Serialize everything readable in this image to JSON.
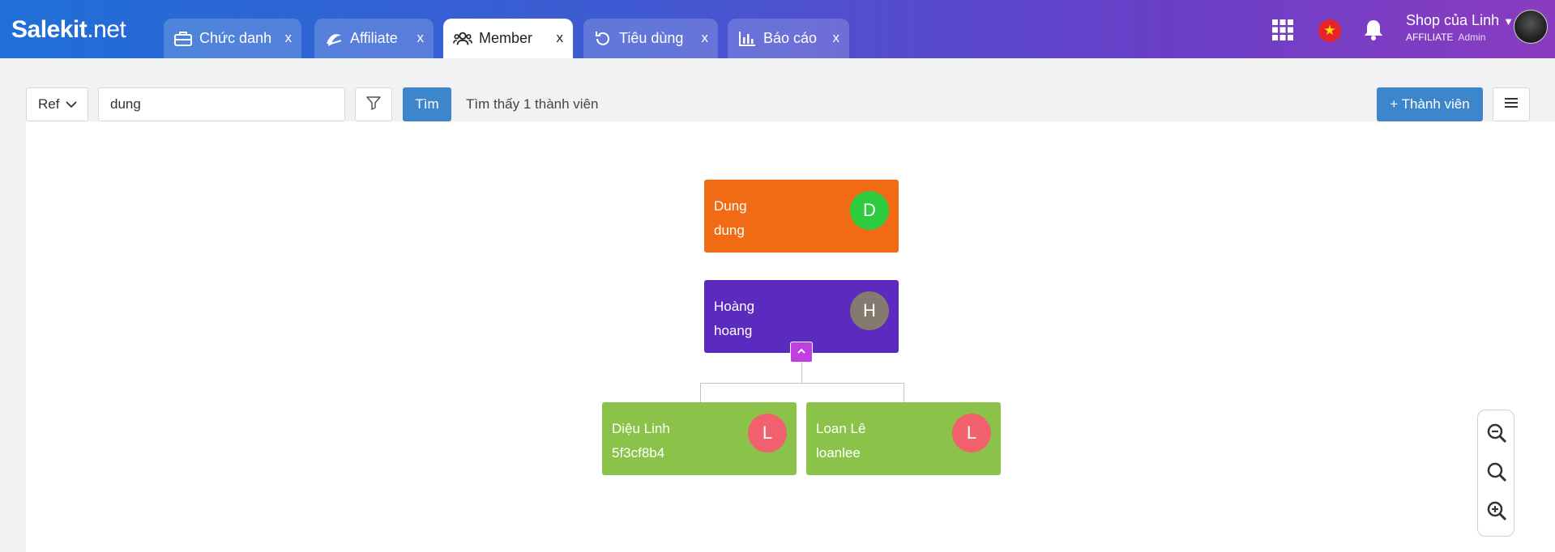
{
  "header": {
    "logo_main": "Salekit",
    "logo_suffix": ".net",
    "tabs": [
      {
        "label": "Chức danh",
        "close": "x",
        "icon": "briefcase-icon"
      },
      {
        "label": "Affiliate",
        "close": "x",
        "icon": "swirl-icon"
      },
      {
        "label": "Member",
        "close": "x",
        "icon": "users-icon",
        "active": true
      },
      {
        "label": "Tiêu dùng",
        "close": "x",
        "icon": "history-icon"
      },
      {
        "label": "Báo cáo",
        "close": "x",
        "icon": "bar-chart-icon"
      }
    ],
    "shop_name": "Shop của Linh",
    "role": "AFFILIATE",
    "role_sub": "Admin",
    "flag_star": "★"
  },
  "toolbar": {
    "select_value": "Ref",
    "search_value": "dung",
    "find_label": "Tìm",
    "result_text": "Tìm thấy 1 thành viên",
    "add_label": "+ Thành viên"
  },
  "tree": {
    "nodes": [
      {
        "name": "Dung",
        "username": "dung",
        "initial": "D",
        "color": "#f06b13",
        "badge_color": "#2ecc40"
      },
      {
        "name": "Hoàng",
        "username": "hoang",
        "initial": "H",
        "color": "#5b2bbf",
        "badge_color": "#857a70"
      },
      {
        "name": "Diệu Linh",
        "username": "5f3cf8b4",
        "initial": "L",
        "color": "#8bc34a",
        "badge_color": "#f2616e"
      },
      {
        "name": "Loan Lê",
        "username": "loanlee",
        "initial": "L",
        "color": "#8bc34a",
        "badge_color": "#f2616e"
      }
    ]
  }
}
